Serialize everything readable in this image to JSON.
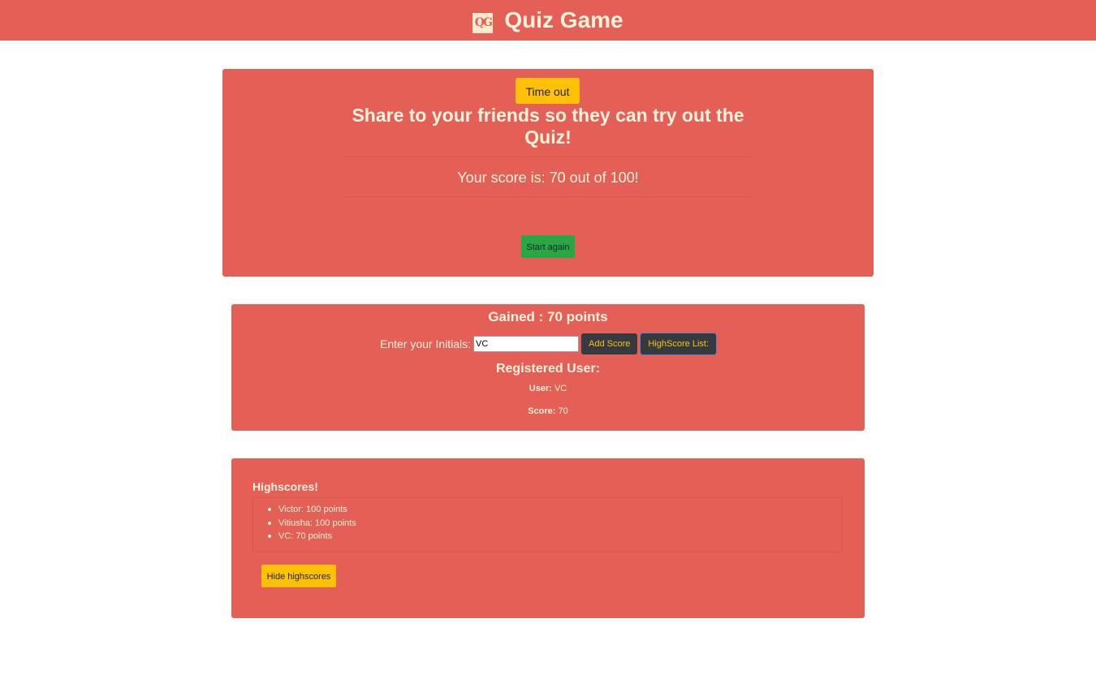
{
  "header": {
    "logo_text": "QG",
    "title": "Quiz Game"
  },
  "quiz": {
    "timer_label": "Time out",
    "share_title": "Share to your friends so they can try out the Quiz!",
    "final_score": "Your score is: 70 out of 100!",
    "restart_label": "Start again"
  },
  "score_form": {
    "gained": "Gained : 70 points",
    "initials_label": "Enter your Initials:",
    "initials_value": "VC",
    "add_score_label": "Add Score",
    "highscore_list_label": "HighScore List:",
    "registered_title": "Registered User:",
    "user_label": "User:",
    "user_value": "VC",
    "score_label": "Score:",
    "score_value": "70"
  },
  "highscores": {
    "title": "Highscores!",
    "entries": [
      "Victor: 100 points",
      "Vitiusha: 100 points",
      "VC: 70 points"
    ],
    "hide_label": "Hide highscores"
  },
  "colors": {
    "primary": "#e45f56",
    "text": "#fff3dc",
    "warning": "#ffc107",
    "success": "#28a745",
    "dark": "#343a40"
  }
}
